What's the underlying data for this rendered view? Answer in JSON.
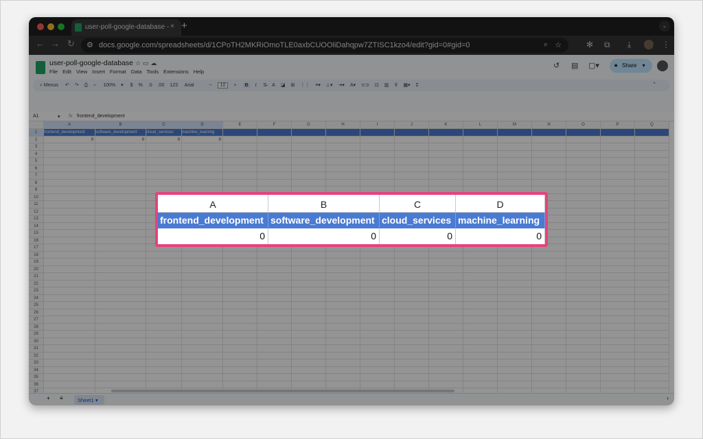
{
  "browser": {
    "tab_title": "user-poll-google-database -",
    "url": "docs.google.com/spreadsheets/d/1CPoTH2MKRiOmoTLE0axbCUOOliDahqpw7ZTISC1kzo4/edit?gid=0#gid=0"
  },
  "sheets": {
    "title": "user-poll-google-database",
    "menu": [
      "File",
      "Edit",
      "View",
      "Insert",
      "Format",
      "Data",
      "Tools",
      "Extensions",
      "Help"
    ],
    "toolbar": {
      "search": "Menus",
      "zoom": "100%",
      "currency": "$",
      "percent": "%",
      "dec_less": ".0",
      "dec_more": ".00",
      "format": "123",
      "font": "Arial",
      "font_size": "10",
      "bold": "B",
      "italic": "I",
      "sum": "Σ"
    },
    "share_label": "Share",
    "name_box": "A1",
    "formula_icon": "fx",
    "formula": "frontend_development",
    "columns": [
      "A",
      "B",
      "C",
      "D",
      "E",
      "F",
      "G",
      "H",
      "I",
      "J",
      "K",
      "L",
      "M",
      "N",
      "O",
      "P",
      "Q"
    ],
    "row_count": 38,
    "cells": [
      [
        "frontend_development",
        "software_development",
        "cloud_services",
        "machine_learning"
      ],
      [
        "0",
        "0",
        "0",
        "0"
      ]
    ],
    "sheet_tab": "Sheet1"
  },
  "callout": {
    "columns": [
      "A",
      "B",
      "C",
      "D"
    ],
    "labels": [
      "frontend_development",
      "software_development",
      "cloud_services",
      "machine_learning"
    ],
    "values": [
      "0",
      "0",
      "0",
      "0"
    ]
  },
  "colors": {
    "accent": "#e6427d",
    "header_fill": "#4a7bd3"
  }
}
